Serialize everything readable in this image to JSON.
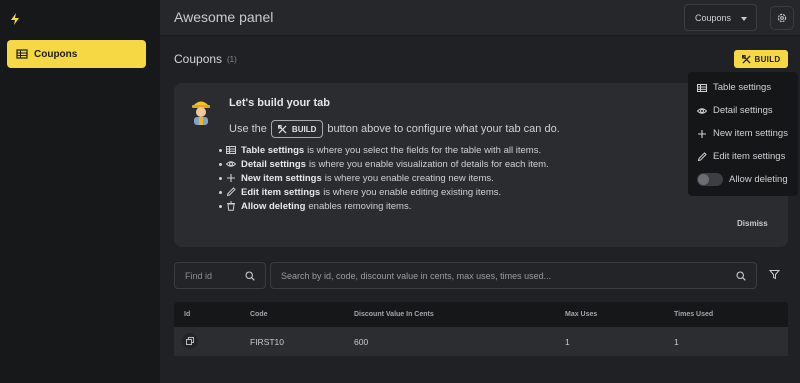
{
  "app": {
    "title": "Awesome panel",
    "logo_icon": "lightning-icon"
  },
  "sidebar": {
    "items": [
      {
        "label": "Coupons",
        "icon": "table-icon",
        "active": true
      }
    ]
  },
  "header": {
    "selected_entity": "Coupons",
    "settings_icon": "gear-icon"
  },
  "section": {
    "title": "Coupons",
    "count": "(1)",
    "build_label": "BUILD"
  },
  "help": {
    "title": "Let's build your tab",
    "usage_prefix": "Use the",
    "usage_suffix": "button above to configure what your tab can do.",
    "bullets": [
      {
        "icon": "table-icon",
        "bold": "Table settings",
        "text": "is where you select the fields for the table with all items."
      },
      {
        "icon": "eye-icon",
        "bold": "Detail settings",
        "text": "is where you enable visualization of details for each item."
      },
      {
        "icon": "plus-icon",
        "bold": "New item settings",
        "text": "is where you enable creating new items."
      },
      {
        "icon": "pencil-icon",
        "bold": "Edit item settings",
        "text": "is where you enable editing existing items."
      },
      {
        "icon": "trash-icon",
        "bold": "Allow deleting",
        "text": "enables removing items."
      }
    ],
    "dismiss": "Dismiss"
  },
  "build_menu": {
    "items": [
      {
        "icon": "table-icon",
        "label": "Table settings"
      },
      {
        "icon": "eye-icon",
        "label": "Detail settings"
      },
      {
        "icon": "plus-icon",
        "label": "New item settings"
      },
      {
        "icon": "pencil-icon",
        "label": "Edit item settings"
      }
    ],
    "toggle": {
      "label": "Allow deleting",
      "on": false
    }
  },
  "search": {
    "find_id_placeholder": "Find id",
    "placeholder": "Search by id, code, discount value in cents, max uses, times used..."
  },
  "table": {
    "columns": [
      "Id",
      "Code",
      "Discount Value In Cents",
      "Max Uses",
      "Times Used"
    ],
    "rows": [
      {
        "code": "FIRST10",
        "discount": "600",
        "max_uses": "1",
        "times_used": "1"
      }
    ]
  },
  "colors": {
    "accent": "#f6d845",
    "background": "#1f2124",
    "sidebar": "#17181a"
  }
}
